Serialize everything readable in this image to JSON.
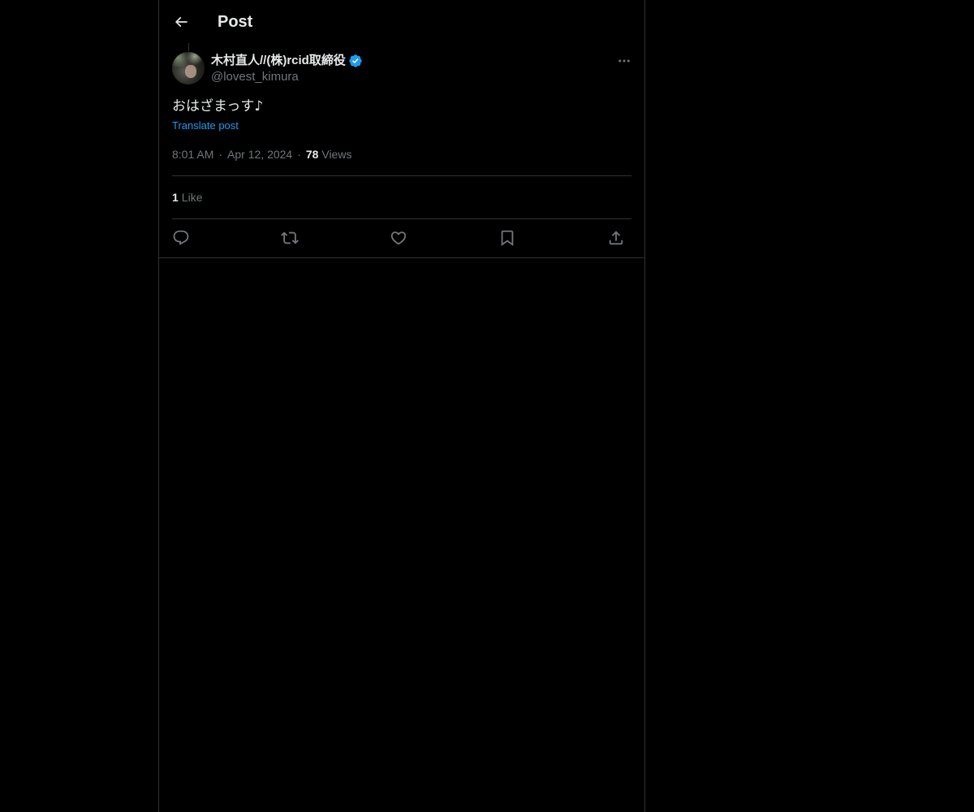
{
  "header": {
    "title": "Post",
    "back_icon": "arrow-left-icon"
  },
  "post": {
    "author": {
      "display_name": "木村直人//(株)rcid取締役",
      "handle": "@lovest_kimura",
      "verified": true,
      "verified_color": "#1d9bf0"
    },
    "text": "おはざまっす♪",
    "translate_label": "Translate post",
    "time": "8:01 AM",
    "date": "Apr 12, 2024",
    "views_count": "78",
    "views_label": "Views",
    "likes_count": "1",
    "likes_label": "Like",
    "separator": "·"
  },
  "actions": [
    {
      "name": "reply",
      "icon": "reply-icon"
    },
    {
      "name": "repost",
      "icon": "repost-icon"
    },
    {
      "name": "like",
      "icon": "heart-icon"
    },
    {
      "name": "bookmark",
      "icon": "bookmark-icon"
    },
    {
      "name": "share",
      "icon": "share-icon"
    }
  ],
  "colors": {
    "background": "#000000",
    "text_primary": "#e7e9ea",
    "text_secondary": "#71767b",
    "accent": "#1d9bf0",
    "border": "#2f3336"
  }
}
